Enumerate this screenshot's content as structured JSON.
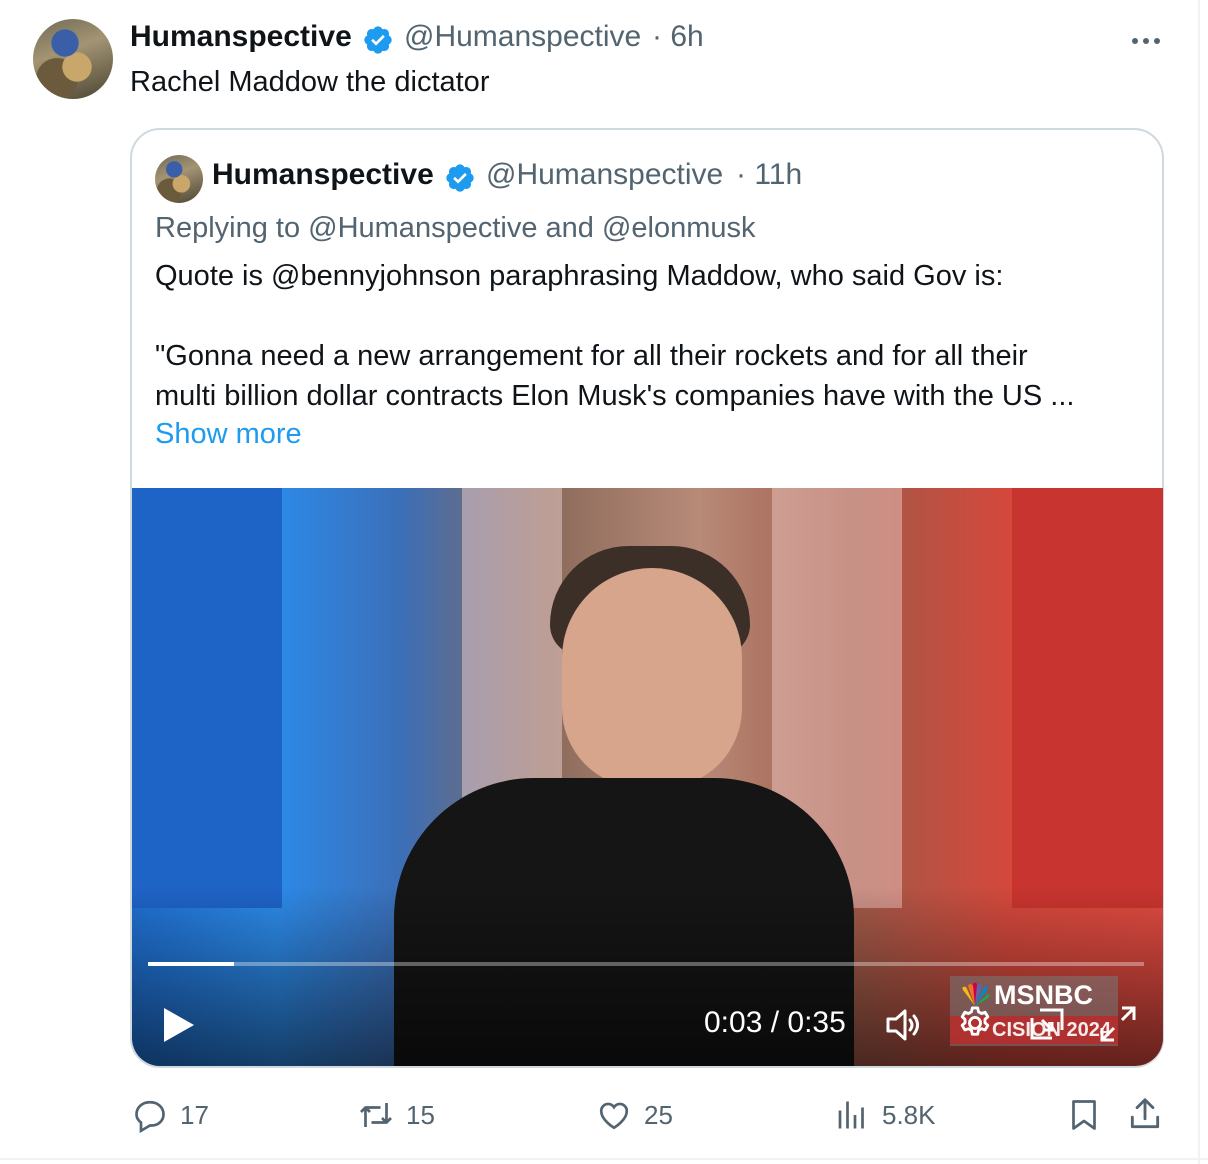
{
  "tweet": {
    "author_name": "Humanspective",
    "author_handle": "@Humanspective",
    "time": "· 6h",
    "text": "Rachel Maddow the dictator"
  },
  "quote": {
    "author_name": "Humanspective",
    "author_handle": "@Humanspective",
    "time": "· 11h",
    "replying_to": "Replying to @Humanspective and @elonmusk",
    "line1": "Quote is @bennyjohnson paraphrasing Maddow, who said Gov is:",
    "line2": "\"Gonna need a new arrangement for all their rockets and for all their",
    "line3": "multi billion dollar contracts Elon Musk's companies have with the US ...",
    "show_more": "Show more"
  },
  "video": {
    "time_display": "0:03 / 0:35",
    "progress_fraction": 0.086,
    "logo_text": "MSNBC",
    "logo_subtext": "CISION 2024"
  },
  "actions": {
    "replies": "17",
    "reposts": "15",
    "likes": "25",
    "views": "5.8K"
  },
  "colors": {
    "accent": "#1d9bf0",
    "secondary_text": "#536471",
    "border": "#cfd9de"
  }
}
